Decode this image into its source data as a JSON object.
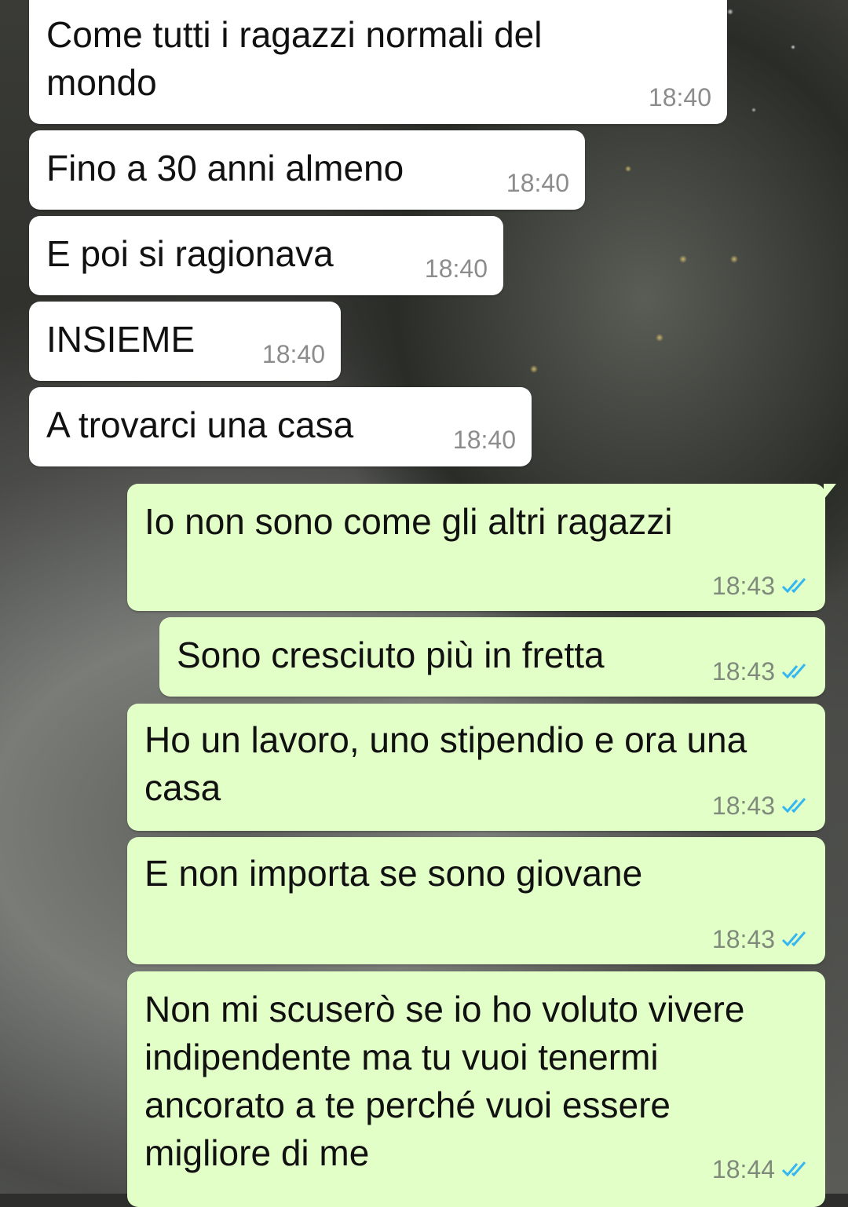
{
  "messages": [
    {
      "dir": "in",
      "text": "Come tutti i ragazzi normali del mondo",
      "time": "18:40"
    },
    {
      "dir": "in",
      "text": "Fino a 30 anni almeno",
      "time": "18:40"
    },
    {
      "dir": "in",
      "text": "E poi si ragionava",
      "time": "18:40"
    },
    {
      "dir": "in",
      "text": "INSIEME",
      "time": "18:40"
    },
    {
      "dir": "in",
      "text": "A trovarci una casa",
      "time": "18:40"
    },
    {
      "dir": "out",
      "text": "Io non sono come gli altri ragazzi",
      "time": "18:43",
      "status": "read"
    },
    {
      "dir": "out",
      "text": "Sono cresciuto più in fretta",
      "time": "18:43",
      "status": "read"
    },
    {
      "dir": "out",
      "text": "Ho un lavoro, uno stipendio e ora una casa",
      "time": "18:43",
      "status": "read"
    },
    {
      "dir": "out",
      "text": "E non importa se sono giovane",
      "time": "18:43",
      "status": "read"
    },
    {
      "dir": "out",
      "text": "Non mi scuserò se io ho voluto vivere indipendente ma tu vuoi tenermi ancorato a te perché vuoi essere migliore di me",
      "time": "18:44",
      "status": "read"
    }
  ],
  "colors": {
    "incoming_bubble": "#ffffff",
    "outgoing_bubble": "#e2ffc7",
    "read_ticks": "#34b7f1"
  },
  "icons": {
    "read_status": "double-check-icon"
  }
}
